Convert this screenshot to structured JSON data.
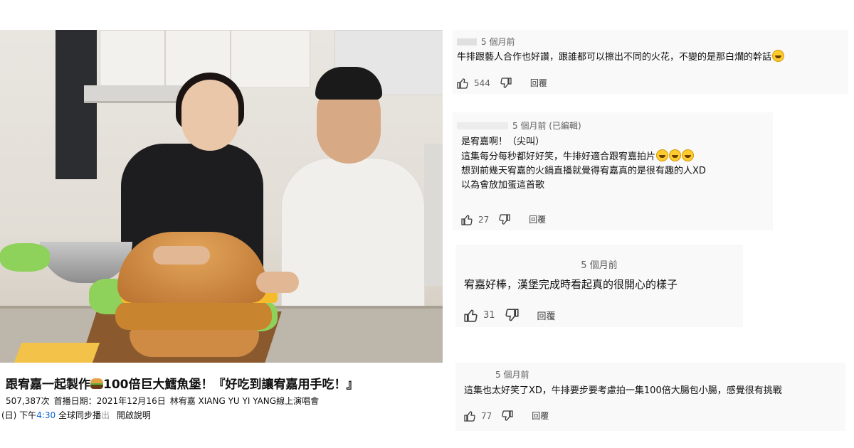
{
  "video": {
    "title_part1": "跟宥嘉一起製作",
    "title_part2": "100倍巨大鱈魚堡！『好吃到讓宥嘉用手吃！』",
    "title_emoji": "hamburger-icon",
    "views": "507,387次",
    "premiere_date": "首播日期：2021年12月16日",
    "channel": "林宥嘉 XIANG YU YI YANG線上演唱會",
    "schedule_prefix": "(日) 下午",
    "schedule_time": "4:30",
    "schedule_suffix": "全球同步播",
    "schedule_faded": "出",
    "open_description": "開啟說明"
  },
  "comments": [
    {
      "time": "5 個月前",
      "edited": "",
      "lines": [
        "牛排跟藝人合作也好讚，跟誰都可以擦出不同的火花，不變的是那白爛的幹話"
      ],
      "emoji_count": 1,
      "likes": "544",
      "reply": "回覆"
    },
    {
      "time": "5 個月前",
      "edited": "(已編輯)",
      "lines": [
        "是宥嘉啊！（尖叫）",
        "這集每分每秒都好好笑，牛排好適合跟宥嘉拍片",
        "想到前幾天宥嘉的火鍋直播就覺得宥嘉真的是很有趣的人XD",
        "以為會放加蛋這首歌"
      ],
      "emoji_count": 3,
      "likes": "27",
      "reply": "回覆"
    },
    {
      "time": "5 個月前",
      "edited": "",
      "lines": [
        "宥嘉好棒，漢堡完成時看起真的很開心的樣子"
      ],
      "emoji_count": 0,
      "likes": "31",
      "reply": "回覆"
    },
    {
      "time": "5 個月前",
      "edited": "",
      "lines": [
        "這集也太好笑了XD，牛排要步要考慮拍一集100倍大腸包小腸，感覺很有挑戰"
      ],
      "emoji_count": 0,
      "likes": "77",
      "reply": "回覆"
    }
  ],
  "colors": {
    "link_blue": "#065fd4",
    "comment_bg": "#f9f9f9",
    "meta_gray": "#606060"
  }
}
